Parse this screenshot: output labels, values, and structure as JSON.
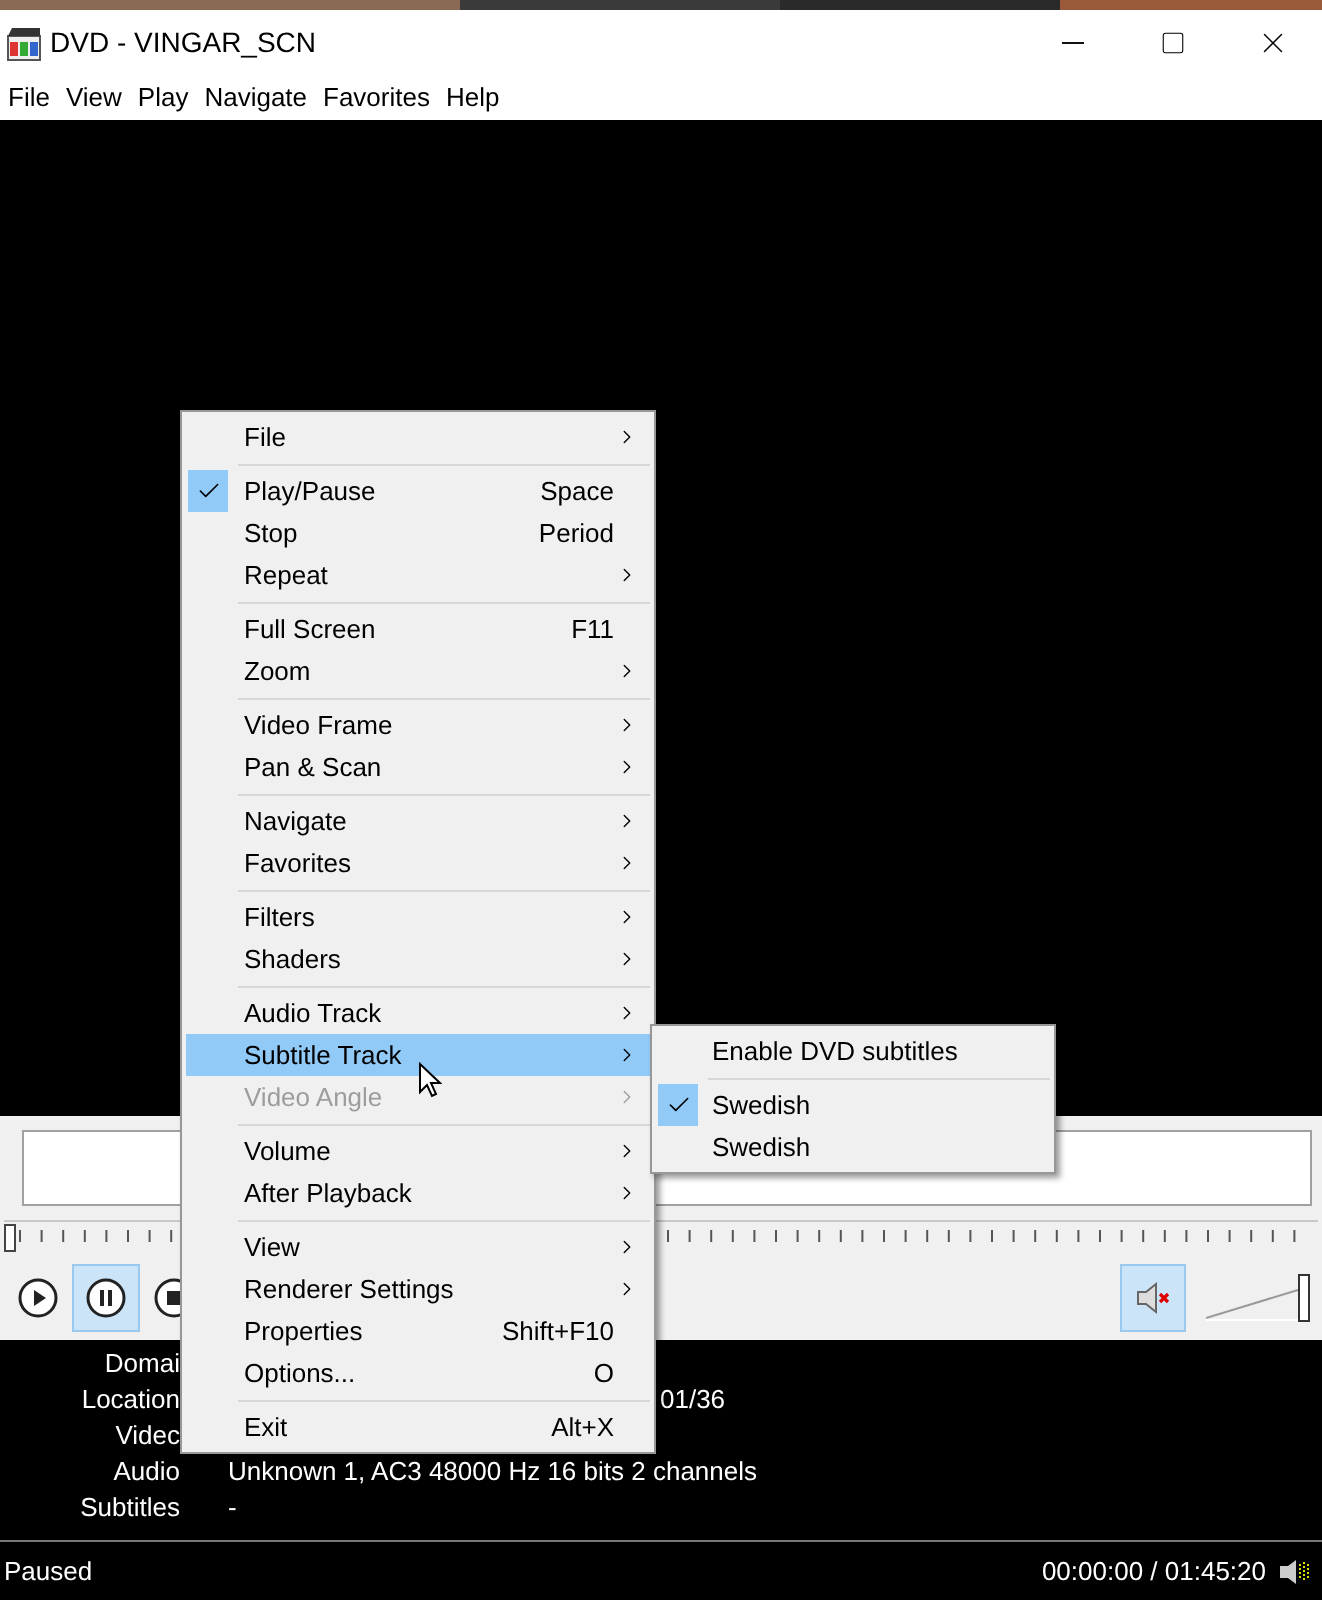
{
  "window": {
    "title": "DVD - VINGAR_SCN"
  },
  "menubar": [
    {
      "label": "File"
    },
    {
      "label": "View"
    },
    {
      "label": "Play"
    },
    {
      "label": "Navigate"
    },
    {
      "label": "Favorites"
    },
    {
      "label": "Help"
    }
  ],
  "context_menu": [
    {
      "kind": "item",
      "label": "File",
      "submenu": true,
      "selected": false
    },
    {
      "kind": "separator"
    },
    {
      "kind": "item",
      "label": "Play/Pause",
      "shortcut": "Space",
      "checked": true,
      "selected": false
    },
    {
      "kind": "item",
      "label": "Stop",
      "shortcut": "Period",
      "selected": false
    },
    {
      "kind": "item",
      "label": "Repeat",
      "submenu": true,
      "selected": false
    },
    {
      "kind": "separator"
    },
    {
      "kind": "item",
      "label": "Full Screen",
      "shortcut": "F11",
      "selected": false
    },
    {
      "kind": "item",
      "label": "Zoom",
      "submenu": true,
      "selected": false
    },
    {
      "kind": "separator"
    },
    {
      "kind": "item",
      "label": "Video Frame",
      "submenu": true,
      "selected": false
    },
    {
      "kind": "item",
      "label": "Pan & Scan",
      "submenu": true,
      "selected": false
    },
    {
      "kind": "separator"
    },
    {
      "kind": "item",
      "label": "Navigate",
      "submenu": true,
      "selected": false
    },
    {
      "kind": "item",
      "label": "Favorites",
      "submenu": true,
      "selected": false
    },
    {
      "kind": "separator"
    },
    {
      "kind": "item",
      "label": "Filters",
      "submenu": true,
      "selected": false
    },
    {
      "kind": "item",
      "label": "Shaders",
      "submenu": true,
      "selected": false
    },
    {
      "kind": "separator"
    },
    {
      "kind": "item",
      "label": "Audio Track",
      "submenu": true,
      "selected": false
    },
    {
      "kind": "item",
      "label": "Subtitle Track",
      "submenu": true,
      "selected": true
    },
    {
      "kind": "item",
      "label": "Video Angle",
      "submenu": true,
      "disabled": true,
      "selected": false
    },
    {
      "kind": "separator"
    },
    {
      "kind": "item",
      "label": "Volume",
      "submenu": true,
      "selected": false
    },
    {
      "kind": "item",
      "label": "After Playback",
      "submenu": true,
      "selected": false
    },
    {
      "kind": "separator"
    },
    {
      "kind": "item",
      "label": "View",
      "submenu": true,
      "selected": false
    },
    {
      "kind": "item",
      "label": "Renderer Settings",
      "submenu": true,
      "selected": false
    },
    {
      "kind": "item",
      "label": "Properties",
      "shortcut": "Shift+F10",
      "selected": false
    },
    {
      "kind": "item",
      "label": "Options...",
      "shortcut": "O",
      "selected": false
    },
    {
      "kind": "separator"
    },
    {
      "kind": "item",
      "label": "Exit",
      "shortcut": "Alt+X",
      "selected": false
    }
  ],
  "submenu": [
    {
      "kind": "item",
      "label": "Enable DVD subtitles",
      "checked": false
    },
    {
      "kind": "separator"
    },
    {
      "kind": "item",
      "label": "Swedish",
      "checked": true
    },
    {
      "kind": "item",
      "label": "Swedish",
      "checked": false
    }
  ],
  "seek_bar": {
    "level": 0
  },
  "controls": [
    {
      "kind": "play",
      "selected": false
    },
    {
      "kind": "pause",
      "selected": true
    },
    {
      "kind": "stop",
      "selected": false
    }
  ],
  "mute_button": {
    "muted": true
  },
  "volume": {
    "level": 1
  },
  "info": [
    {
      "label": "Domai"
    },
    {
      "label": "Location",
      "value": "01/36"
    },
    {
      "label": "Videc"
    },
    {
      "label": "Audio",
      "value": "Unknown 1, AC3 48000 Hz 16 bits 2 channels"
    },
    {
      "label": "Subtitles",
      "value": "-"
    }
  ],
  "status_bar": {
    "status": "Paused",
    "time": "00:00:00 / 01:45:20"
  }
}
